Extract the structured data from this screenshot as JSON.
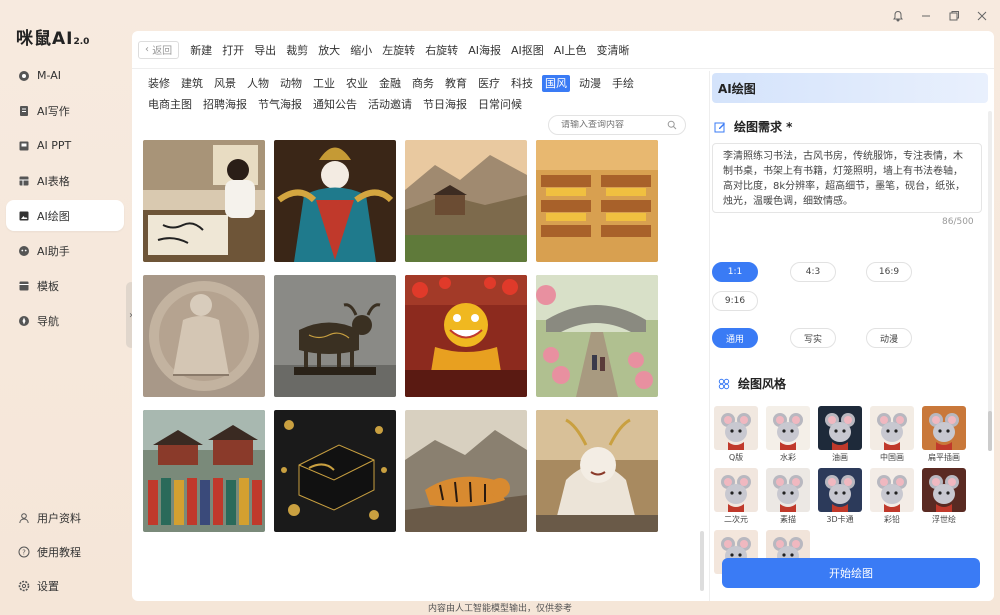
{
  "app": {
    "logo": "咪鼠AI",
    "logo_version": "2.0"
  },
  "colors": {
    "accent": "#3a7bf5",
    "sidebar_bg": "#f6e7d8",
    "panel_bg": "#ffffff"
  },
  "sidebar": {
    "items": [
      {
        "label": "M-AI",
        "icon": "m-ai-icon"
      },
      {
        "label": "AI写作",
        "icon": "writing-icon"
      },
      {
        "label": "AI PPT",
        "icon": "ppt-icon"
      },
      {
        "label": "AI表格",
        "icon": "table-icon"
      },
      {
        "label": "AI绘图",
        "icon": "drawing-icon",
        "active": true
      },
      {
        "label": "AI助手",
        "icon": "assistant-icon"
      },
      {
        "label": "模板",
        "icon": "template-icon"
      },
      {
        "label": "导航",
        "icon": "navigation-icon"
      }
    ],
    "bottom": [
      {
        "label": "用户资料",
        "icon": "user-icon"
      },
      {
        "label": "使用教程",
        "icon": "help-icon"
      },
      {
        "label": "设置",
        "icon": "gear-icon"
      }
    ]
  },
  "toolbar": {
    "back": "返回",
    "tools": [
      "新建",
      "打开",
      "导出",
      "裁剪",
      "放大",
      "缩小",
      "左旋转",
      "右旋转",
      "AI海报",
      "AI抠图",
      "AI上色",
      "变清晰"
    ]
  },
  "categories": {
    "row1": [
      "装修",
      "建筑",
      "风景",
      "人物",
      "动物",
      "工业",
      "农业",
      "金融",
      "商务",
      "教育",
      "医疗",
      "科技",
      "国风",
      "动漫",
      "手绘"
    ],
    "row2": [
      "电商主图",
      "招聘海报",
      "节气海报",
      "通知公告",
      "活动邀请",
      "节日海报",
      "日常问候"
    ],
    "active": "国风"
  },
  "search": {
    "placeholder": "请输入查询内容",
    "value": ""
  },
  "right_panel": {
    "title": "AI绘图",
    "requirement_title": "绘图需求 *",
    "prompt": "李清照练习书法，古风书房，传统服饰，专注表情，木制书桌，书架上有书籍，灯笼照明，墙上有书法卷轴，高对比度，8k分辨率，超高细节，墨笔，砚台，纸张，烛光，温暖色调，细致情感。",
    "counter": "86/500",
    "ratios": [
      "1:1",
      "4:3",
      "16:9",
      "9:16"
    ],
    "active_ratio": "1:1",
    "modes": [
      "通用",
      "写实",
      "动漫"
    ],
    "active_mode": "通用",
    "style_title": "绘图风格",
    "styles": [
      "Q版",
      "水彩",
      "油画",
      "中国画",
      "扁平插画",
      "二次元",
      "素描",
      "3D卡通",
      "彩铅",
      "浮世绘",
      "",
      ""
    ],
    "start_button": "开始绘图"
  },
  "footer": "内容由人工智能模型输出，仅供参考"
}
